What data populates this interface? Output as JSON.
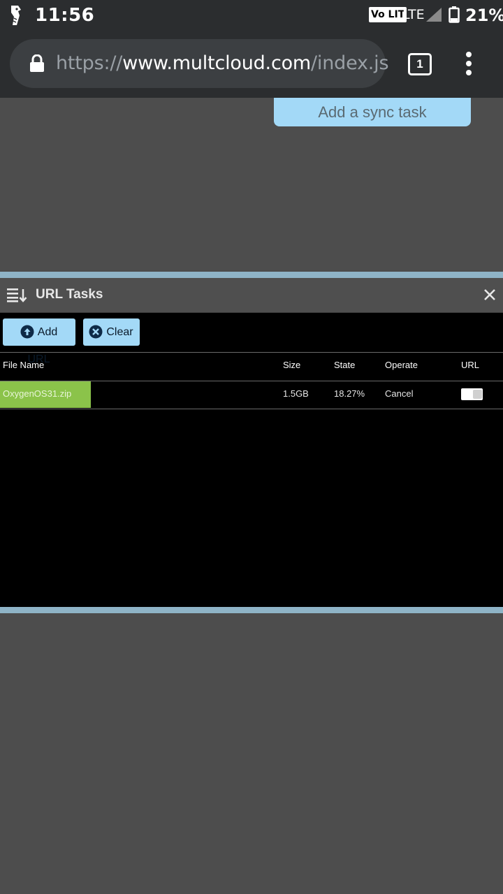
{
  "status_bar": {
    "time": "11:56",
    "volte": "Vo LIT",
    "network": "LTE",
    "battery": "21%",
    "icons": [
      "app-logo-icon",
      "volte-icon",
      "signal-icon",
      "battery-icon"
    ]
  },
  "browser": {
    "url_prefix": "https://",
    "url_host": "www.multcloud.com",
    "url_path": "/index.js",
    "tab_count": "1",
    "icons": [
      "lock-icon",
      "tabs-icon",
      "overflow-menu-icon"
    ]
  },
  "page": {
    "sync_button": "Add a sync task"
  },
  "panel": {
    "title": "URL Tasks",
    "add_url": "Add URL",
    "clear": "Clear",
    "columns": {
      "file_name": "File Name",
      "size": "Size",
      "state": "State",
      "operate": "Operate",
      "url": "URL"
    },
    "rows": [
      {
        "file_name": "OxygenOS31.zip",
        "size": "1.5GB",
        "state": "18.27%",
        "operate": "Cancel",
        "progress_color": "#8bc34a"
      }
    ]
  },
  "colors": {
    "accent_button": "#a3d9f7",
    "divider": "#8fb4c7",
    "progress": "#8bc34a",
    "page_background": "#4d4d4d"
  }
}
